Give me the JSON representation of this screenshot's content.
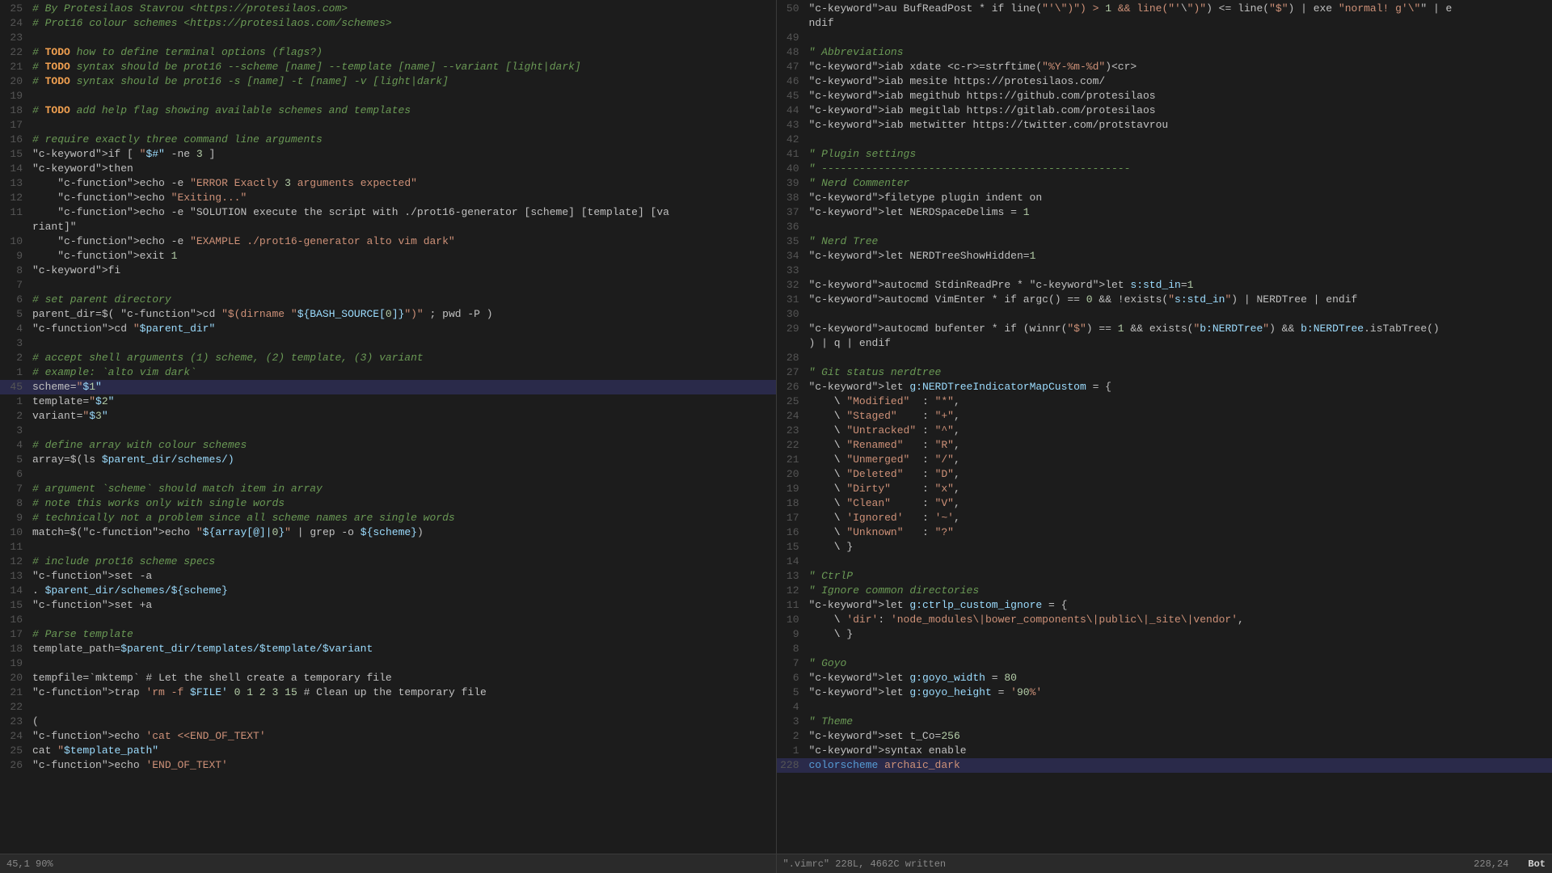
{
  "left_pane": {
    "lines": [
      {
        "num": "25",
        "content": "# By Protesilaos Stavrou <https://protesilaos.com>",
        "type": "comment"
      },
      {
        "num": "24",
        "content": "# Prot16 colour schemes <https://protesilaos.com/schemes>",
        "type": "comment"
      },
      {
        "num": "23",
        "content": "",
        "type": "empty"
      },
      {
        "num": "22",
        "content": "# TODO how to define terminal options (flags?)",
        "type": "todo"
      },
      {
        "num": "21",
        "content": "# TODO syntax should be prot16 --scheme [name] --template [name] --variant [light|dark]",
        "type": "todo"
      },
      {
        "num": "20",
        "content": "# TODO syntax should be prot16 -s [name] -t [name] -v [light|dark]",
        "type": "todo"
      },
      {
        "num": "19",
        "content": "",
        "type": "empty"
      },
      {
        "num": "18",
        "content": "# TODO add help flag showing available schemes and templates",
        "type": "todo"
      },
      {
        "num": "17",
        "content": "",
        "type": "empty"
      },
      {
        "num": "16",
        "content": "# require exactly three command line arguments",
        "type": "comment"
      },
      {
        "num": "15",
        "content": "if [ \"$#\" -ne 3 ]",
        "type": "code"
      },
      {
        "num": "14",
        "content": "then",
        "type": "code"
      },
      {
        "num": "13",
        "content": "    echo -e \"ERROR Exactly 3 arguments expected\"",
        "type": "code"
      },
      {
        "num": "12",
        "content": "    echo \"Exiting...\"",
        "type": "code"
      },
      {
        "num": "11",
        "content": "    echo -e \"SOLUTION execute the script with ./prot16-generator [scheme] [template] [va",
        "type": "code"
      },
      {
        "num": "",
        "content": "riant]\"",
        "type": "code-cont"
      },
      {
        "num": "10",
        "content": "    echo -e \"EXAMPLE ./prot16-generator alto vim dark\"",
        "type": "code"
      },
      {
        "num": "9",
        "content": "    exit 1",
        "type": "code"
      },
      {
        "num": "8",
        "content": "fi",
        "type": "code"
      },
      {
        "num": "7",
        "content": "",
        "type": "empty"
      },
      {
        "num": "6",
        "content": "# set parent directory",
        "type": "comment"
      },
      {
        "num": "5",
        "content": "parent_dir=$( cd \"$(dirname \"${BASH_SOURCE[0]}\")\" ; pwd -P )",
        "type": "code"
      },
      {
        "num": "4",
        "content": "cd \"$parent_dir\"",
        "type": "code"
      },
      {
        "num": "3",
        "content": "",
        "type": "empty"
      },
      {
        "num": "2",
        "content": "# accept shell arguments (1) scheme, (2) template, (3) variant",
        "type": "comment"
      },
      {
        "num": "1",
        "content": "# example: `alto vim dark`",
        "type": "comment"
      },
      {
        "num": "45",
        "content": "scheme=\"$1\"",
        "type": "code",
        "highlighted": true
      },
      {
        "num": "1",
        "content": "template=\"$2\"",
        "type": "code"
      },
      {
        "num": "2",
        "content": "variant=\"$3\"",
        "type": "code"
      },
      {
        "num": "3",
        "content": "",
        "type": "empty"
      },
      {
        "num": "4",
        "content": "# define array with colour schemes",
        "type": "comment"
      },
      {
        "num": "5",
        "content": "array=$(ls $parent_dir/schemes/)",
        "type": "code"
      },
      {
        "num": "6",
        "content": "",
        "type": "empty"
      },
      {
        "num": "7",
        "content": "# argument `scheme` should match item in array",
        "type": "comment"
      },
      {
        "num": "8",
        "content": "# note this works only with single words",
        "type": "comment"
      },
      {
        "num": "9",
        "content": "# technically not a problem since all scheme names are single words",
        "type": "comment"
      },
      {
        "num": "10",
        "content": "match=$(echo \"${array[@]|0}\" | grep -o ${scheme})",
        "type": "code"
      },
      {
        "num": "11",
        "content": "",
        "type": "empty"
      },
      {
        "num": "12",
        "content": "# include prot16 scheme specs",
        "type": "comment"
      },
      {
        "num": "13",
        "content": "set -a",
        "type": "code"
      },
      {
        "num": "14",
        "content": ". $parent_dir/schemes/${scheme}",
        "type": "code"
      },
      {
        "num": "15",
        "content": "set +a",
        "type": "code"
      },
      {
        "num": "16",
        "content": "",
        "type": "empty"
      },
      {
        "num": "17",
        "content": "# Parse template",
        "type": "comment"
      },
      {
        "num": "18",
        "content": "template_path=$parent_dir/templates/$template/$variant",
        "type": "code"
      },
      {
        "num": "19",
        "content": "",
        "type": "empty"
      },
      {
        "num": "20",
        "content": "tempfile=`mktemp` # Let the shell create a temporary file",
        "type": "code"
      },
      {
        "num": "21",
        "content": "trap 'rm -f $FILE' 0 1 2 3 15 # Clean up the temporary file",
        "type": "code"
      },
      {
        "num": "22",
        "content": "",
        "type": "empty"
      },
      {
        "num": "23",
        "content": "(",
        "type": "code"
      },
      {
        "num": "24",
        "content": "echo 'cat <<END_OF_TEXT'",
        "type": "code"
      },
      {
        "num": "25",
        "content": "cat \"$template_path\"",
        "type": "code"
      },
      {
        "num": "26",
        "content": "echo 'END_OF_TEXT'",
        "type": "code"
      }
    ],
    "statusbar": {
      "position": "45,1",
      "percent": "90%"
    }
  },
  "right_pane": {
    "lines": [
      {
        "num": "50",
        "content": "au BufReadPost * if line(\"'\\\")\") > 1 && line(\"'\\\")\") <= line(\"$\") | exe \"normal! g'\\\"\" | e"
      },
      {
        "num": "",
        "content": "ndif"
      },
      {
        "num": "49",
        "content": ""
      },
      {
        "num": "48",
        "content": "\" Abbreviations"
      },
      {
        "num": "47",
        "content": "iab xdate <c-r>=strftime(\"%Y-%m-%d\")<cr>"
      },
      {
        "num": "46",
        "content": "iab mesite https://protesilaos.com/"
      },
      {
        "num": "45",
        "content": "iab megithub https://github.com/protesilaos"
      },
      {
        "num": "44",
        "content": "iab megitlab https://gitlab.com/protesilaos"
      },
      {
        "num": "43",
        "content": "iab metwitter https://twitter.com/protstavrou"
      },
      {
        "num": "42",
        "content": ""
      },
      {
        "num": "41",
        "content": "\" Plugin settings"
      },
      {
        "num": "40",
        "content": "\" -------------------------------------------------"
      },
      {
        "num": "39",
        "content": "\" Nerd Commenter"
      },
      {
        "num": "38",
        "content": "filetype plugin indent on"
      },
      {
        "num": "37",
        "content": "let NERDSpaceDelims = 1"
      },
      {
        "num": "36",
        "content": ""
      },
      {
        "num": "35",
        "content": "\" Nerd Tree"
      },
      {
        "num": "34",
        "content": "let NERDTreeShowHidden=1"
      },
      {
        "num": "33",
        "content": ""
      },
      {
        "num": "32",
        "content": "autocmd StdinReadPre * let s:std_in=1"
      },
      {
        "num": "31",
        "content": "autocmd VimEnter * if argc() == 0 && !exists(\"s:std_in\") | NERDTree | endif"
      },
      {
        "num": "30",
        "content": ""
      },
      {
        "num": "29",
        "content": "autocmd bufenter * if (winnr(\"$\") == 1 && exists(\"b:NERDTree\") && b:NERDTree.isTabTree()"
      },
      {
        "num": "",
        "content": ") | q | endif"
      },
      {
        "num": "28",
        "content": ""
      },
      {
        "num": "27",
        "content": "\" Git status nerdtree"
      },
      {
        "num": "26",
        "content": "let g:NERDTreeIndicatorMapCustom = {"
      },
      {
        "num": "25",
        "content": "    \\ \"Modified\"  : \"*\","
      },
      {
        "num": "24",
        "content": "    \\ \"Staged\"    : \"+\","
      },
      {
        "num": "23",
        "content": "    \\ \"Untracked\" : \"^\","
      },
      {
        "num": "22",
        "content": "    \\ \"Renamed\"   : \"R\","
      },
      {
        "num": "21",
        "content": "    \\ \"Unmerged\"  : \"/\","
      },
      {
        "num": "20",
        "content": "    \\ \"Deleted\"   : \"D\","
      },
      {
        "num": "19",
        "content": "    \\ \"Dirty\"     : \"x\","
      },
      {
        "num": "18",
        "content": "    \\ \"Clean\"     : \"V\","
      },
      {
        "num": "17",
        "content": "    \\ 'Ignored'   : '~',"
      },
      {
        "num": "16",
        "content": "    \\ \"Unknown\"   : \"?\""
      },
      {
        "num": "15",
        "content": "    \\ }"
      },
      {
        "num": "14",
        "content": ""
      },
      {
        "num": "13",
        "content": "\" CtrlP"
      },
      {
        "num": "12",
        "content": "\" Ignore common directories"
      },
      {
        "num": "11",
        "content": "let g:ctrlp_custom_ignore = {"
      },
      {
        "num": "10",
        "content": "    \\ 'dir': 'node_modules\\|bower_components\\|public\\|_site\\|vendor',"
      },
      {
        "num": "9",
        "content": "    \\ }"
      },
      {
        "num": "8",
        "content": ""
      },
      {
        "num": "7",
        "content": "\" Goyo"
      },
      {
        "num": "6",
        "content": "let g:goyo_width = 80"
      },
      {
        "num": "5",
        "content": "let g:goyo_height = '90%'"
      },
      {
        "num": "4",
        "content": ""
      },
      {
        "num": "3",
        "content": "\" Theme"
      },
      {
        "num": "2",
        "content": "set t_Co=256"
      },
      {
        "num": "1",
        "content": "syntax enable"
      },
      {
        "num": "228",
        "content": "colorscheme archaic_dark",
        "highlighted": true
      }
    ],
    "statusbar": {
      "filename": "\".vimrc\" 228L, 4662C written",
      "position": "228,24",
      "mode": "Bot"
    }
  }
}
